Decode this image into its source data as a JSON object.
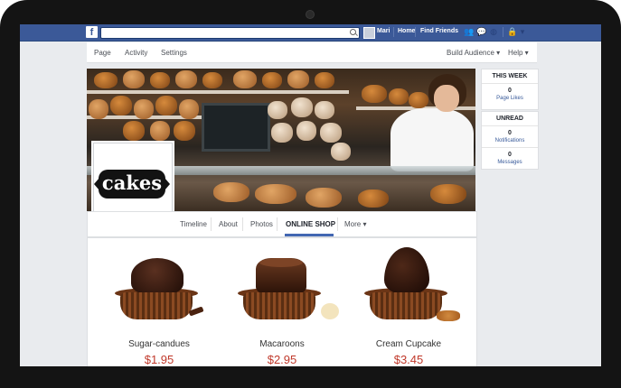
{
  "topbar": {
    "logo": "f",
    "user_name": "Mari",
    "home": "Home",
    "find_friends": "Find Friends"
  },
  "page_nav": {
    "page": "Page",
    "activity": "Activity",
    "settings": "Settings",
    "build_audience": "Build Audience ▾",
    "help": "Help ▾"
  },
  "profile": {
    "logo_text": "cakes"
  },
  "tabs": [
    {
      "label": "Timeline"
    },
    {
      "label": "About"
    },
    {
      "label": "Photos"
    },
    {
      "label": "ONLINE SHOP",
      "active": true
    },
    {
      "label": "More ▾"
    }
  ],
  "sidebar": {
    "this_week": "THIS WEEK",
    "page_likes_count": "0",
    "page_likes_label": "Page Likes",
    "unread": "UNREAD",
    "notifications_count": "0",
    "notifications_label": "Notifications",
    "messages_count": "0",
    "messages_label": "Messages"
  },
  "products": [
    {
      "name": "Sugar-candues",
      "price": "$1.95"
    },
    {
      "name": "Macaroons",
      "price": "$2.95"
    },
    {
      "name": "Cream Cupcake",
      "price": "$3.45"
    }
  ],
  "colors": {
    "facebook_blue": "#3b5998",
    "price_red": "#c0392b",
    "active_tab_underline": "#4267b2"
  }
}
